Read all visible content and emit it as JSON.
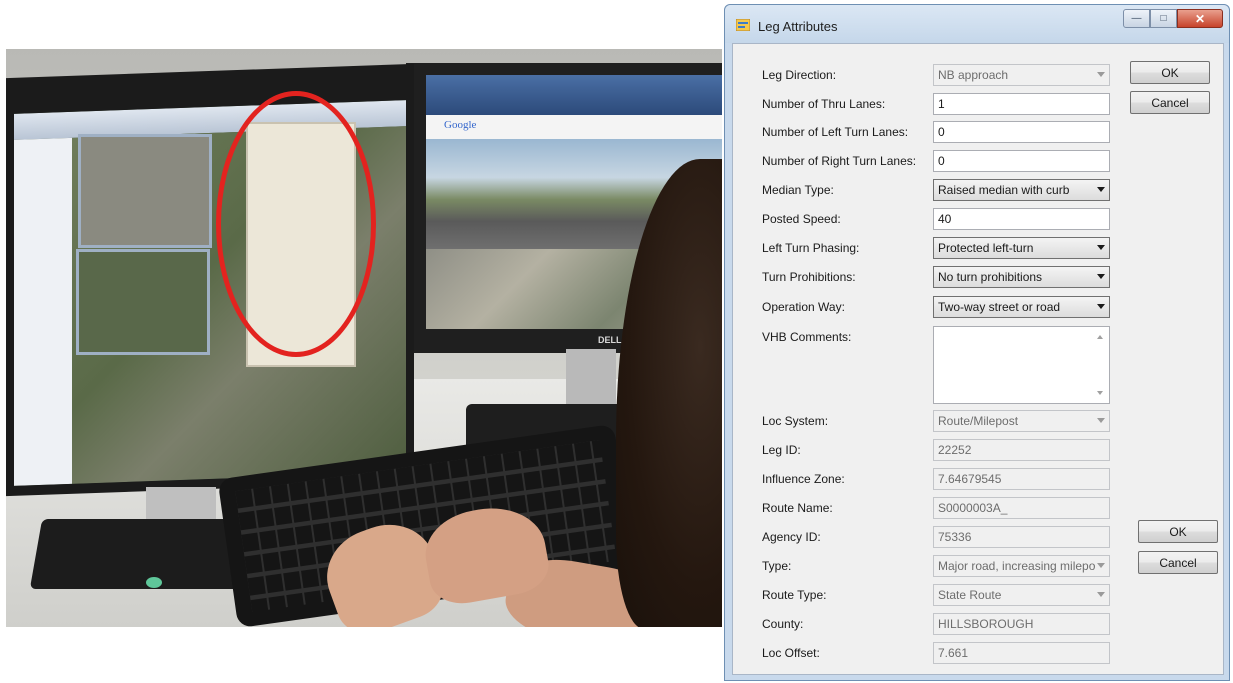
{
  "dialog": {
    "title": "Leg Attributes",
    "buttons": {
      "ok_top": "OK",
      "cancel_top": "Cancel",
      "ok_bottom": "OK",
      "cancel_bottom": "Cancel"
    },
    "fields": {
      "leg_direction": {
        "label": "Leg Direction:",
        "value": "NB approach"
      },
      "thru_lanes": {
        "label": "Number of Thru Lanes:",
        "value": "1"
      },
      "left_turn_lanes": {
        "label": "Number of Left Turn Lanes:",
        "value": "0"
      },
      "right_turn_lanes": {
        "label": "Number of Right Turn Lanes:",
        "value": "0"
      },
      "median_type": {
        "label": "Median Type:",
        "value": "Raised median with curb"
      },
      "posted_speed": {
        "label": "Posted Speed:",
        "value": "40"
      },
      "left_turn_phasing": {
        "label": "Left Turn Phasing:",
        "value": "Protected left-turn"
      },
      "turn_prohibitions": {
        "label": "Turn Prohibitions:",
        "value": "No turn prohibitions"
      },
      "operation_way": {
        "label": "Operation Way:",
        "value": "Two-way street or road"
      },
      "vhb_comments": {
        "label": "VHB Comments:",
        "value": ""
      },
      "loc_system": {
        "label": "Loc System:",
        "value": "Route/Milepost"
      },
      "leg_id": {
        "label": "Leg ID:",
        "value": "22252"
      },
      "influence_zone": {
        "label": "Influence Zone:",
        "value": "7.64679545"
      },
      "route_name": {
        "label": "Route Name:",
        "value": "S0000003A_"
      },
      "agency_id": {
        "label": "Agency ID:",
        "value": "75336"
      },
      "type": {
        "label": "Type:",
        "value": "Major road, increasing milepo"
      },
      "route_type": {
        "label": "Route Type:",
        "value": "State Route"
      },
      "county": {
        "label": "County:",
        "value": "HILLSBOROUGH"
      },
      "loc_offset": {
        "label": "Loc Offset:",
        "value": "7.661"
      }
    }
  },
  "photo": {
    "brand": "DELL",
    "google_logo": "Google"
  }
}
